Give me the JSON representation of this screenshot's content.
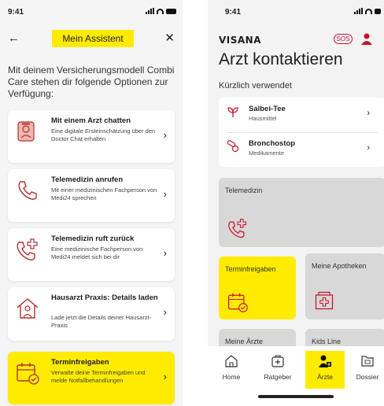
{
  "status_bar": {
    "time": "9:41"
  },
  "assistant": {
    "title": "Mein Assistent",
    "intro": "Mit deinem Versicherungsmodell Combi Care stehen dir folgende Optionen zur Verfügung:",
    "options": [
      {
        "title": "Mit einem Arzt chatten",
        "description": "Eine digitale Ersteinschätzung über den Doctor Chat erhalten",
        "icon": "doctor-chat-icon"
      },
      {
        "title": "Telemedizin anrufen",
        "description": "Mit einer medizinischen Fachperson von Medi24 sprechen",
        "icon": "phone-icon"
      },
      {
        "title": "Telemedizin ruft zurück",
        "description": "Eine medizinische Fachperson von Medi24 meldet sich bei dir",
        "icon": "phone-callback-icon"
      },
      {
        "title": "Hausarzt Praxis: Details laden",
        "description": "Lade jetzt die Details deiner Hausarzt-Praxis",
        "icon": "house-doctor-icon"
      },
      {
        "title": "Terminfreigaben",
        "description": "Verwalte deine Terminfreigaben und melde Notfallbehandlungen",
        "icon": "calendar-check-icon"
      }
    ],
    "highlight_color": "#ffeb00"
  },
  "arzt": {
    "logo": "VISANA",
    "sos": "SOS",
    "title": "Arzt kontaktieren",
    "recent_label": "Kürzlich verwendet",
    "recent": [
      {
        "title": "Salbei-Tee",
        "subtitle": "Hausmittel",
        "icon": "herb-icon"
      },
      {
        "title": "Bronchostop",
        "subtitle": "Medikamente",
        "icon": "pills-icon"
      }
    ],
    "tiles": [
      {
        "label": "Telemedizin",
        "icon": "phone-callback-icon"
      },
      {
        "label": "Terminfreigaben",
        "icon": "calendar-check-icon"
      },
      {
        "label": "Meine Apotheken",
        "icon": "pharmacy-icon"
      },
      {
        "label": "Meine Ärzte",
        "icon": ""
      },
      {
        "label": "Kids Line",
        "icon": ""
      }
    ],
    "tabs": [
      {
        "label": "Home",
        "icon": "home-icon"
      },
      {
        "label": "Ratgeber",
        "icon": "first-aid-icon"
      },
      {
        "label": "Ärzte",
        "icon": "doctor-icon"
      },
      {
        "label": "Dossier",
        "icon": "dossier-icon"
      }
    ],
    "accent_red": "#c8102e"
  }
}
